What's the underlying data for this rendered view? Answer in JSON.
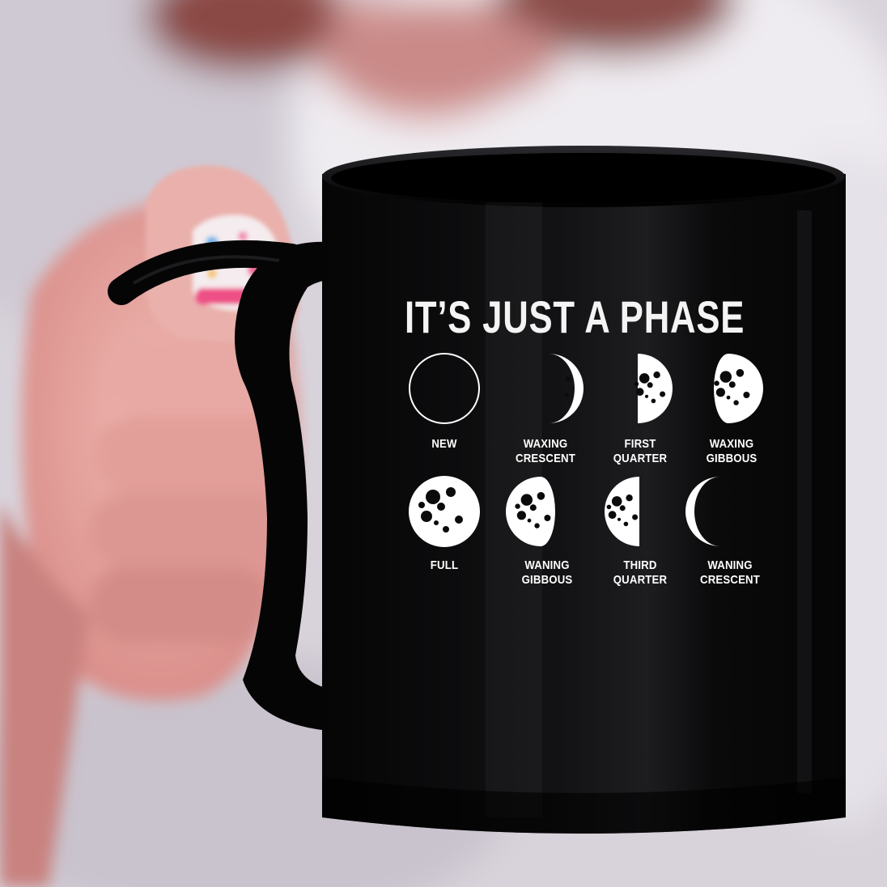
{
  "mug": {
    "title": "IT’S JUST A PHASE",
    "color": "#0b0b0c",
    "print_color": "#ffffff"
  },
  "phases": [
    {
      "label": "NEW",
      "kind": "new"
    },
    {
      "label": "WAXING\nCRESCENT",
      "kind": "waxing-crescent"
    },
    {
      "label": "FIRST\nQUARTER",
      "kind": "first-quarter"
    },
    {
      "label": "WAXING\nGIBBOUS",
      "kind": "waxing-gibbous"
    },
    {
      "label": "FULL",
      "kind": "full"
    },
    {
      "label": "WANING\nGIBBOUS",
      "kind": "waning-gibbous"
    },
    {
      "label": "THIRD\nQUARTER",
      "kind": "third-quarter"
    },
    {
      "label": "WANING\nCRESCENT",
      "kind": "waning-crescent"
    }
  ],
  "colors": {
    "background": "#d9d4dc",
    "shirt": "#e9e6ec",
    "skin": "#e7a9a4",
    "hair": "#7c3a36",
    "nail_pink": "#f06c9a",
    "nail_blue": "#6fb4e8"
  }
}
